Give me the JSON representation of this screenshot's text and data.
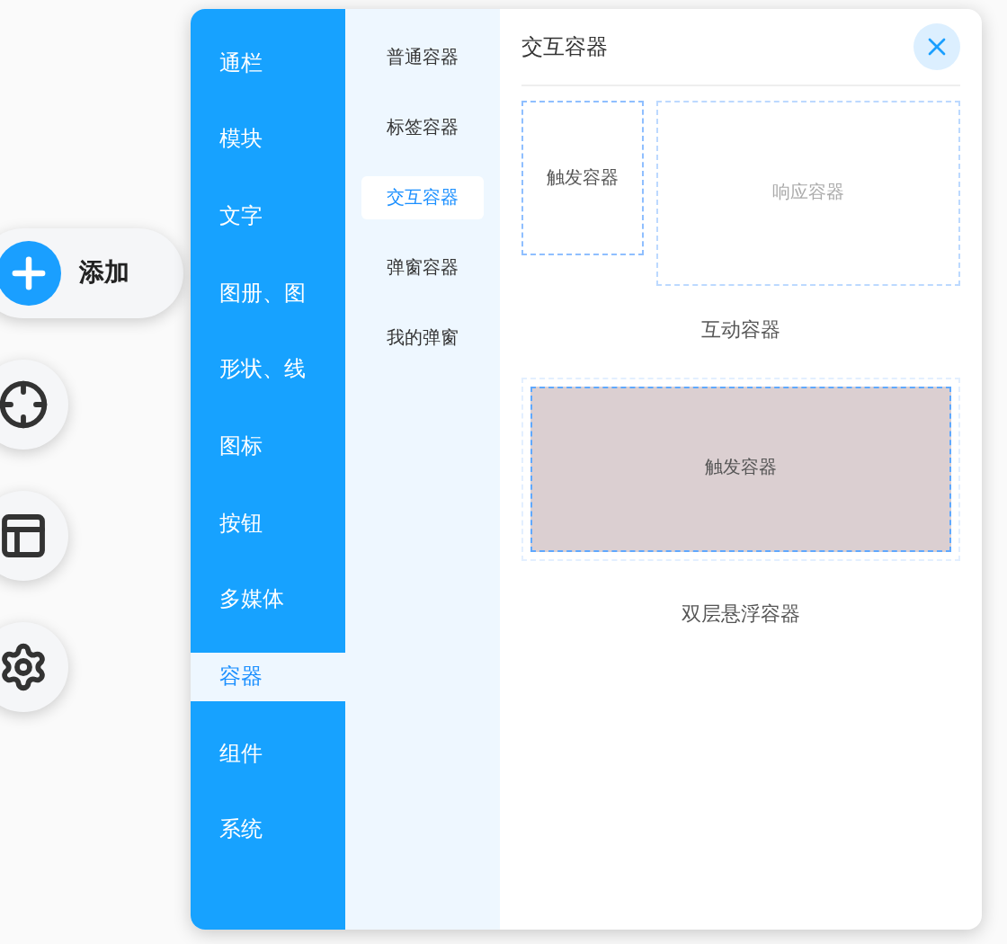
{
  "toolbar": {
    "add_label": "添加"
  },
  "categories": [
    {
      "label": "通栏",
      "selected": false
    },
    {
      "label": "模块",
      "selected": false
    },
    {
      "label": "文字",
      "selected": false
    },
    {
      "label": "图册、图",
      "selected": false
    },
    {
      "label": "形状、线",
      "selected": false
    },
    {
      "label": "图标",
      "selected": false
    },
    {
      "label": "按钮",
      "selected": false
    },
    {
      "label": "多媒体",
      "selected": false
    },
    {
      "label": "容器",
      "selected": true
    },
    {
      "label": "组件",
      "selected": false
    },
    {
      "label": "系统",
      "selected": false
    }
  ],
  "subcategories": [
    {
      "label": "普通容器",
      "selected": false
    },
    {
      "label": "标签容器",
      "selected": false
    },
    {
      "label": "交互容器",
      "selected": true
    },
    {
      "label": "弹窗容器",
      "selected": false
    },
    {
      "label": "我的弹窗",
      "selected": false
    }
  ],
  "content": {
    "title": "交互容器",
    "templates": [
      {
        "kind": "interactive",
        "trigger": "触发容器",
        "response": "响应容器",
        "caption": "互动容器"
      },
      {
        "kind": "hover",
        "trigger": "触发容器",
        "caption": "双层悬浮容器"
      }
    ]
  }
}
